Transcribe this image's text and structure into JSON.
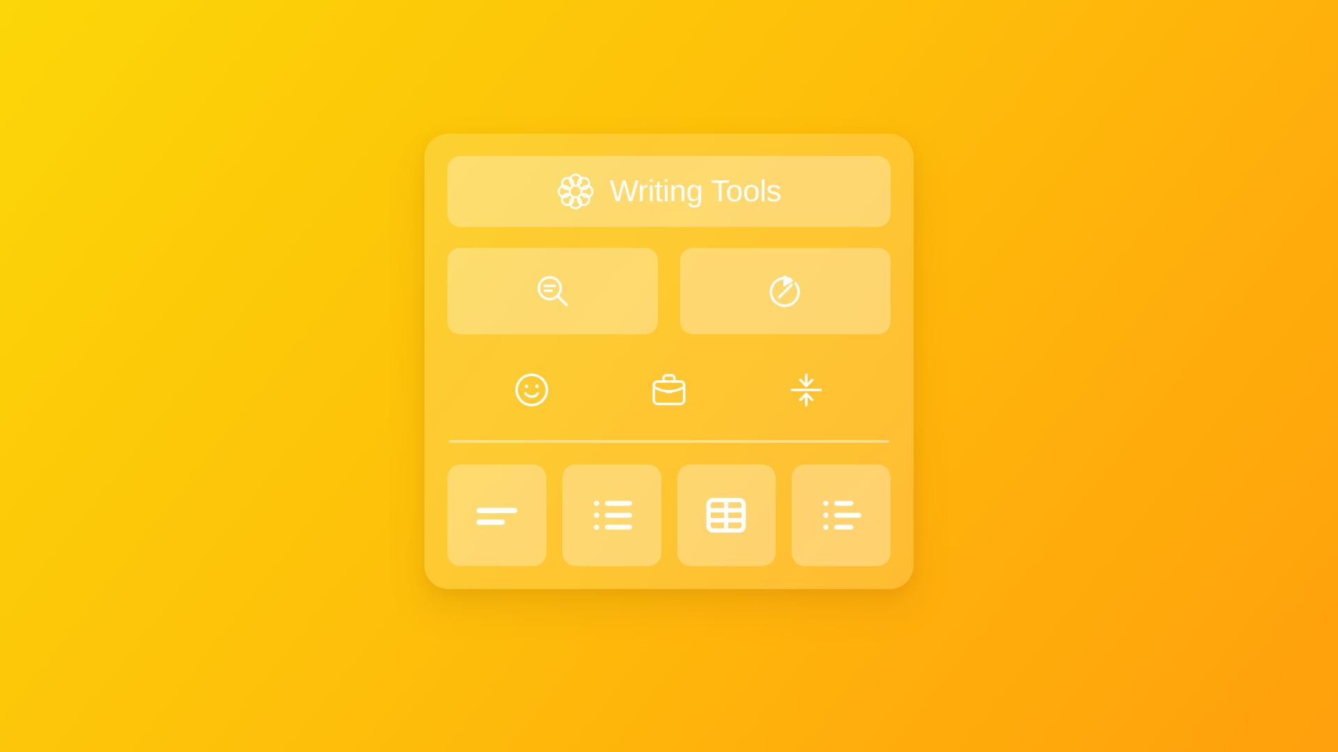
{
  "background": {
    "gradient_from": "#FCD608",
    "gradient_to": "#FFA00C",
    "gradient_angle_deg": 128
  },
  "panel": {
    "surface_color": "rgba(255,255,255,0.16)",
    "tile_color": "rgba(255,255,255,0.30)",
    "icon_color": "#FFFFFF"
  },
  "header": {
    "title": "Writing Tools",
    "icon": "sparkle-rosette-icon"
  },
  "actions": [
    {
      "id": "proofread",
      "icon": "magnifier-text-icon"
    },
    {
      "id": "rewrite",
      "icon": "rewrite-circular-arrow-icon"
    }
  ],
  "tones": [
    {
      "id": "friendly",
      "icon": "smiley-face-icon"
    },
    {
      "id": "professional",
      "icon": "briefcase-icon"
    },
    {
      "id": "concise",
      "icon": "compress-arrows-icon"
    }
  ],
  "formats": [
    {
      "id": "summary",
      "icon": "summary-lines-icon"
    },
    {
      "id": "list",
      "icon": "bullet-list-icon"
    },
    {
      "id": "table",
      "icon": "table-grid-icon"
    },
    {
      "id": "key-points",
      "icon": "key-points-list-icon"
    }
  ]
}
